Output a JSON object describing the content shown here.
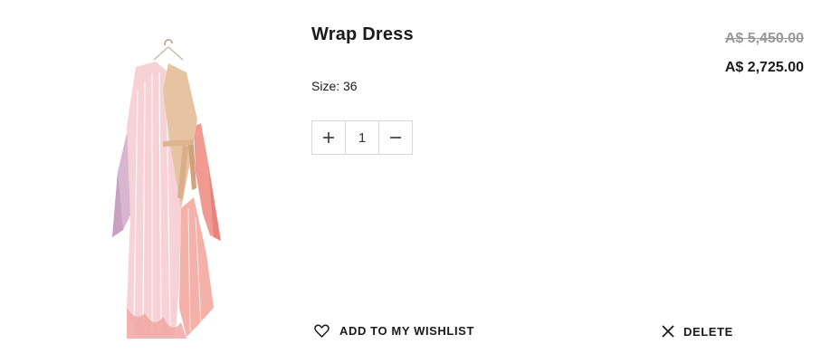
{
  "product": {
    "title": "Wrap Dress",
    "price_original": "A$ 5,450.00",
    "price_current": "A$ 2,725.00",
    "size_label": "Size:",
    "size_value": "36"
  },
  "quantity": {
    "value": "1",
    "increment_icon": "plus-icon",
    "decrement_icon": "minus-icon"
  },
  "actions": {
    "wishlist_label": "ADD TO MY WISHLIST",
    "wishlist_icon": "heart-icon",
    "delete_label": "DELETE",
    "delete_icon": "close-icon"
  },
  "colors": {
    "text": "#1a1a1a",
    "muted": "#9a9a9a",
    "border": "#d9d9d9"
  }
}
